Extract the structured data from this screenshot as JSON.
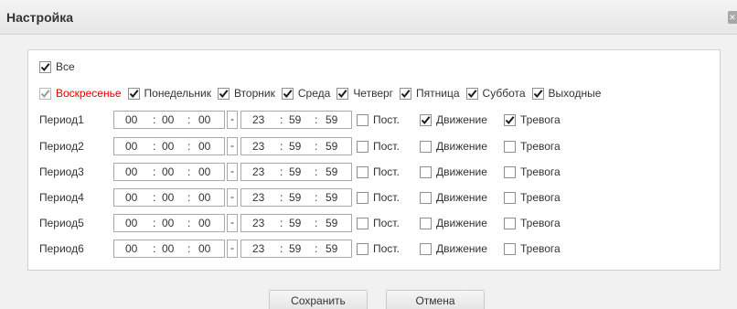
{
  "dialog": {
    "title": "Настройка",
    "close_icon": "close-icon"
  },
  "all_checkbox": {
    "label": "Все",
    "checked": true
  },
  "days": [
    {
      "label": "Воскресенье",
      "checked": true,
      "disabled": true,
      "color": "#e60000"
    },
    {
      "label": "Понедельник",
      "checked": true
    },
    {
      "label": "Вторник",
      "checked": true
    },
    {
      "label": "Среда",
      "checked": true
    },
    {
      "label": "Четверг",
      "checked": true
    },
    {
      "label": "Пятница",
      "checked": true
    },
    {
      "label": "Суббота",
      "checked": true
    },
    {
      "label": "Выходные",
      "checked": true
    }
  ],
  "periods": [
    {
      "label": "Период1",
      "start": [
        "00",
        "00",
        "00"
      ],
      "end": [
        "23",
        "59",
        "59"
      ],
      "post": false,
      "motion": true,
      "alarm": true
    },
    {
      "label": "Период2",
      "start": [
        "00",
        "00",
        "00"
      ],
      "end": [
        "23",
        "59",
        "59"
      ],
      "post": false,
      "motion": false,
      "alarm": false
    },
    {
      "label": "Период3",
      "start": [
        "00",
        "00",
        "00"
      ],
      "end": [
        "23",
        "59",
        "59"
      ],
      "post": false,
      "motion": false,
      "alarm": false
    },
    {
      "label": "Период4",
      "start": [
        "00",
        "00",
        "00"
      ],
      "end": [
        "23",
        "59",
        "59"
      ],
      "post": false,
      "motion": false,
      "alarm": false
    },
    {
      "label": "Период5",
      "start": [
        "00",
        "00",
        "00"
      ],
      "end": [
        "23",
        "59",
        "59"
      ],
      "post": false,
      "motion": false,
      "alarm": false
    },
    {
      "label": "Период6",
      "start": [
        "00",
        "00",
        "00"
      ],
      "end": [
        "23",
        "59",
        "59"
      ],
      "post": false,
      "motion": false,
      "alarm": false
    }
  ],
  "time_separator": ":",
  "range_separator": "-",
  "options": {
    "post": "Пост.",
    "motion": "Движение",
    "alarm": "Тревога"
  },
  "buttons": {
    "save": "Сохранить",
    "cancel": "Отмена"
  }
}
